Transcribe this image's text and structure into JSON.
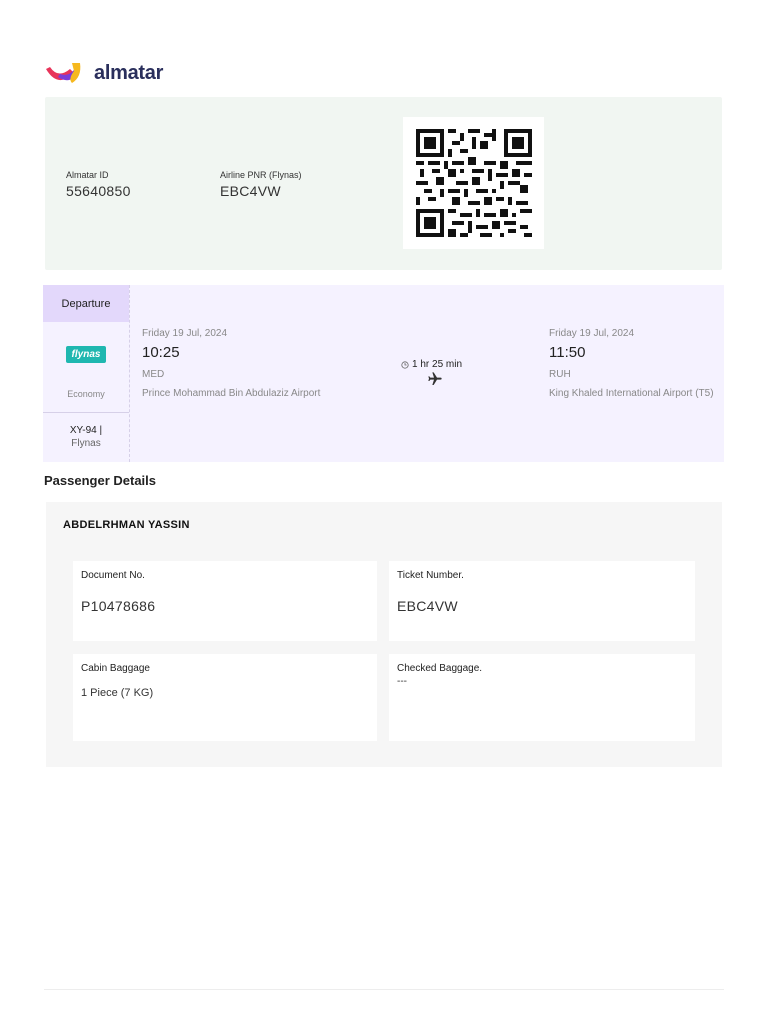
{
  "brand": {
    "name": "almatar"
  },
  "booking": {
    "almatar_id_label": "Almatar ID",
    "almatar_id": "55640850",
    "pnr_label": "Airline PNR (Flynas)",
    "pnr": "EBC4VW"
  },
  "flight": {
    "tab_label": "Departure",
    "airline_logo_text": "flynas",
    "cabin": "Economy",
    "flight_number": "XY-94 |",
    "airline": "Flynas",
    "departure": {
      "date": "Friday 19 Jul, 2024",
      "time": "10:25",
      "code": "MED",
      "airport": "Prince Mohammad Bin Abdulaziz Airport"
    },
    "duration": "1 hr 25 min",
    "arrival": {
      "date": "Friday 19 Jul, 2024",
      "time": "11:50",
      "code": "RUH",
      "airport": "King Khaled International Airport (T5)"
    }
  },
  "passenger": {
    "section_title": "Passenger Details",
    "name": "ABDELRHMAN YASSIN",
    "document_label": "Document No.",
    "document_no": "P10478686",
    "ticket_label": "Ticket Number.",
    "ticket_no": "EBC4VW",
    "cabin_baggage_label": "Cabin Baggage",
    "cabin_baggage": "1 Piece (7 KG)",
    "checked_baggage_label": "Checked Baggage.",
    "checked_baggage": "---"
  },
  "colors": {
    "booking_bg": "#f1f6f2",
    "flight_bg": "#f5f2ff",
    "tab_bg": "#e3d8fb",
    "flynas_teal": "#1fb7b0",
    "brand_navy": "#2a2f5c"
  }
}
